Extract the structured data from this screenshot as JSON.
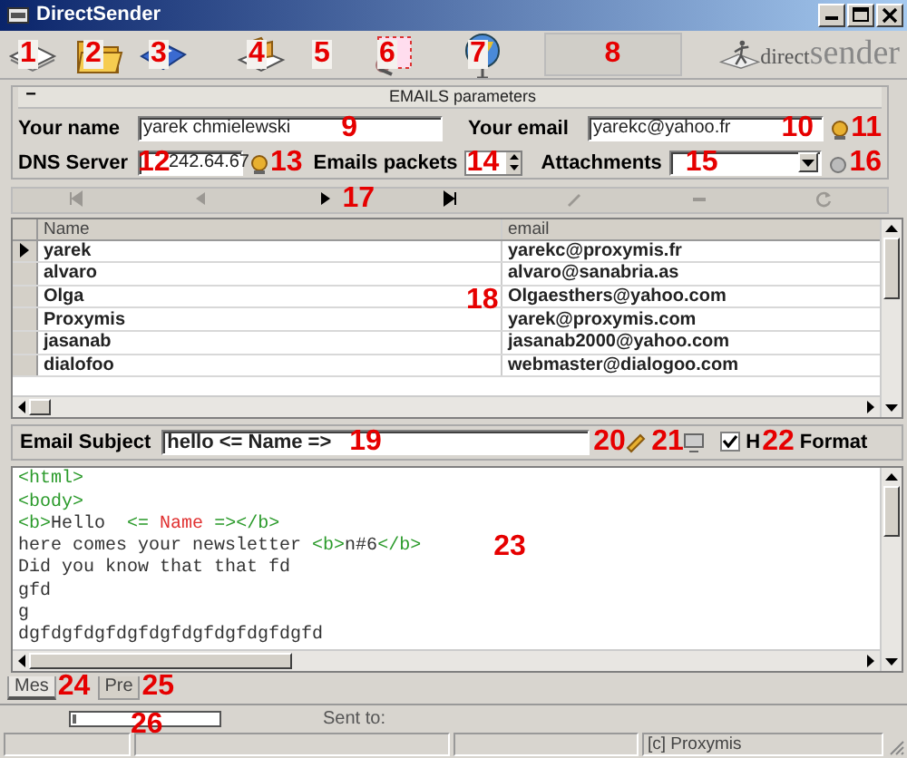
{
  "window": {
    "title": "DirectSender"
  },
  "toolbar": {
    "buttons": [
      {
        "kind": "page",
        "callout": "1"
      },
      {
        "kind": "folder",
        "callout": "2"
      },
      {
        "kind": "disk",
        "callout": "3"
      },
      {
        "kind": "import",
        "callout": "4"
      },
      {
        "kind": "blank",
        "callout": "5"
      },
      {
        "kind": "select",
        "callout": "6"
      },
      {
        "kind": "globe",
        "callout": "7"
      }
    ],
    "status_panel": {
      "callout": "8"
    },
    "logo": {
      "word_1": "direct",
      "word_2": "sender"
    }
  },
  "params": {
    "collapse": "−",
    "title": "EMAILS parameters",
    "your_name": {
      "label": "Your name",
      "value": "yarek chmielewski",
      "callout": "9"
    },
    "your_email": {
      "label": "Your email",
      "value": "yarekc@yahoo.fr",
      "callout": "10"
    },
    "email_button": {
      "callout": "11"
    },
    "dns_server": {
      "label": "DNS Server",
      "value": "242.64.67",
      "callout": "12"
    },
    "dns_button": {
      "callout": "13"
    },
    "emails_packets": {
      "label": "Emails packets",
      "callout": "14"
    },
    "attachments": {
      "label": "Attachments",
      "callout": "15"
    },
    "attach_button": {
      "callout": "16"
    }
  },
  "navigator": {
    "callout": "17",
    "buttons": [
      {
        "kind": "first",
        "disabled": true
      },
      {
        "kind": "prior",
        "disabled": true
      },
      {
        "kind": "next",
        "disabled": false
      },
      {
        "kind": "last",
        "disabled": false
      },
      {
        "kind": "edit",
        "disabled": true
      },
      {
        "kind": "post",
        "disabled": true
      },
      {
        "kind": "refresh",
        "disabled": true
      }
    ]
  },
  "table": {
    "callout": "18",
    "columns": [
      "Name",
      "email"
    ],
    "rows": [
      {
        "cells": [
          "yarek",
          "yarekc@proxymis.fr"
        ],
        "selected": true
      },
      {
        "cells": [
          "alvaro",
          "alvaro@sanabria.as"
        ],
        "selected": false
      },
      {
        "cells": [
          "Olga",
          "Olgaesthers@yahoo.com"
        ],
        "selected": false
      },
      {
        "cells": [
          "Proxymis",
          "yarek@proxymis.com"
        ],
        "selected": false
      },
      {
        "cells": [
          "jasanab",
          "jasanab2000@yahoo.com"
        ],
        "selected": false
      },
      {
        "cells": [
          "dialofoo",
          "webmaster@dialogoo.com"
        ],
        "selected": false
      }
    ]
  },
  "subject": {
    "label": "Email Subject",
    "value": "hello  <= Name =>",
    "callout": "19",
    "buttons": [
      {
        "kind": "pencil",
        "callout": "20"
      },
      {
        "kind": "screen",
        "callout": "21"
      }
    ],
    "html_format": {
      "label_start": "H",
      "label_end": "Format",
      "checked": true,
      "callout": "22"
    }
  },
  "editor": {
    "callout": "23",
    "lines": [
      [
        {
          "kind": "tag",
          "text": "<html>"
        }
      ],
      [
        {
          "kind": "tag",
          "text": "<body>"
        }
      ],
      [
        {
          "kind": "tag",
          "text": "<b>"
        },
        {
          "kind": "text",
          "text": "Hello  "
        },
        {
          "kind": "tag",
          "text": "<= "
        },
        {
          "kind": "var",
          "text": "Name"
        },
        {
          "kind": "tag",
          "text": " =></b>"
        }
      ],
      [
        {
          "kind": "text",
          "text": "here comes your newsletter "
        },
        {
          "kind": "tag",
          "text": "<b>"
        },
        {
          "kind": "text",
          "text": "n#6"
        },
        {
          "kind": "tag",
          "text": "</b>"
        }
      ],
      [
        {
          "kind": "text",
          "text": "Did you know that that fd"
        }
      ],
      [
        {
          "kind": "text",
          "text": "gfd"
        }
      ],
      [
        {
          "kind": "text",
          "text": "g"
        }
      ],
      [
        {
          "kind": "text",
          "text": "dgfdgfdgfdgfdgfdgfdgfdgfdgfd"
        }
      ]
    ]
  },
  "tabs": [
    {
      "label": "Mes",
      "selected": true,
      "callout": "24"
    },
    {
      "label": "Pre",
      "selected": false,
      "callout": "25"
    }
  ],
  "progress": {
    "level": 0.03,
    "callout": "26",
    "sent_to": "Sent to:"
  },
  "status_bar": {
    "copyright": "[c] Proxymis"
  }
}
